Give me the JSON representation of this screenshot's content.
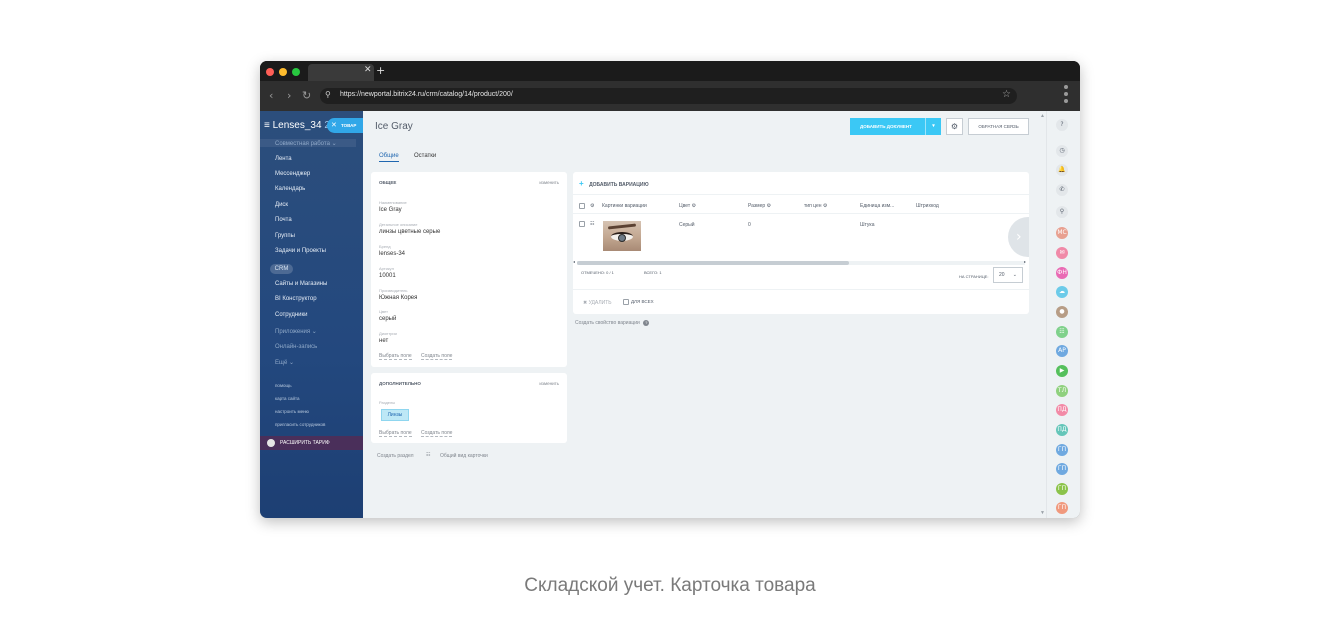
{
  "browser": {
    "url": "https://newportal.bitrix24.ru/crm/catalog/14/product/200/",
    "tab_close": "✕",
    "tab_new": "+",
    "nav_back": "‹",
    "nav_forward": "›",
    "nav_reload": "↻",
    "search_icon": "⚲",
    "star_icon": "☆"
  },
  "sidebar": {
    "logo_text": "Lenses_34",
    "logo_num": "24",
    "hamburger": "≡",
    "tovar_close": "✕",
    "tovar_label": "ТОВАР",
    "group_label": "Совместная работа ⌄",
    "items": [
      "Лента",
      "Мессенджер",
      "Календарь",
      "Диск",
      "Почта",
      "Группы",
      "Задачи и Проекты"
    ],
    "crm": "CRM",
    "items2": [
      "Сайты и Магазины",
      "BI Конструктор",
      "Сотрудники",
      "Приложения ⌄",
      "Онлайн-запись",
      "Ещё ⌄"
    ],
    "small_links": [
      "помощь",
      "карта сайта",
      "настроить меню",
      "пригласить сотрудников"
    ],
    "expand_label": "РАСШИРИТЬ ТАРИФ"
  },
  "header": {
    "title": "Ice Gray",
    "add_doc": "ДОБАВИТЬ ДОКУМЕНТ",
    "add_doc_arrow": "▾",
    "gear": "⚙",
    "feedback": "ОБРАТНАЯ СВЯЗЬ"
  },
  "tabs": [
    "Общие",
    "Остатки"
  ],
  "general_card": {
    "title": "ОБЩЕЕ",
    "edit": "изменить",
    "fields": [
      {
        "label": "Наименование",
        "value": "Ice Gray"
      },
      {
        "label": "Детальное описание",
        "value": "линзы цветные серые"
      },
      {
        "label": "Бренд",
        "value": "lenses-34"
      },
      {
        "label": "Артикул",
        "value": "10001"
      },
      {
        "label": "Производитель",
        "value": "Южная Корея"
      },
      {
        "label": "Цвет",
        "value": "серый"
      },
      {
        "label": "Диоптрии",
        "value": "нет"
      }
    ],
    "choose_field": "Выбрать поле",
    "create_field": "Создать поле"
  },
  "extra_card": {
    "title": "ДОПОЛНИТЕЛЬНО",
    "edit": "изменить",
    "sections_label": "Разделы",
    "section_chip": "Линзы",
    "choose_field": "Выбрать поле",
    "create_field": "Создать поле"
  },
  "below": {
    "create_section": "Создать раздел",
    "card_icon": "☷",
    "general_view": "Общий вид карточки"
  },
  "variations": {
    "add_plus": "+",
    "add_label": "ДОБАВИТЬ ВАРИАЦИЮ",
    "gear": "⚙",
    "columns": [
      "Картинки вариации",
      "Цвет ⚙",
      "Размер ⚙",
      "тип цен ⚙",
      "Единица изм...",
      "Штрихкод"
    ],
    "row": {
      "icon": "☷",
      "color": "Серый",
      "size": "0",
      "unit": "Штука"
    },
    "selected": "ОТМЕЧЕНО: 0 / 1",
    "total": "ВСЕГО: 1",
    "per_page_label": "НА СТРАНИЦЕ:",
    "per_page_value": "20",
    "per_page_chevron": "⌄",
    "delete_icon": "✖",
    "delete_label": "УДАЛИТЬ",
    "for_all": "ДЛЯ ВСЕХ",
    "next_icon": "›",
    "scroll_left": "◂",
    "scroll_right": "▸",
    "create_property": "Создать свойство вариации",
    "help_icon": "?"
  },
  "rightbar": {
    "scroll_up": "▲",
    "scroll_down": "▼",
    "icons": [
      {
        "name": "help-icon",
        "text": "?",
        "color": "#e3e7ea"
      },
      {
        "name": "timer-icon",
        "text": "◷",
        "color": "#e3e7ea"
      },
      {
        "name": "bell-icon",
        "text": "🔔",
        "color": "#e3e7ea"
      },
      {
        "name": "phone-icon",
        "text": "✆",
        "color": "#e3e7ea"
      },
      {
        "name": "search-icon",
        "text": "⚲",
        "color": "#e3e7ea"
      },
      {
        "name": "avatar-mc",
        "text": "МС",
        "color": "#e8a090"
      },
      {
        "name": "avatar-pink",
        "text": "✉",
        "color": "#f08aa8"
      },
      {
        "name": "avatar-fn",
        "text": "ФН",
        "color": "#e96bb4"
      },
      {
        "name": "avatar-chat",
        "text": "☁",
        "color": "#6ccbe9"
      },
      {
        "name": "avatar-photo",
        "text": "●",
        "color": "#b79d86"
      },
      {
        "name": "avatar-green",
        "text": "☷",
        "color": "#7fd18b"
      },
      {
        "name": "avatar-ap",
        "text": "АР",
        "color": "#6fa9e0"
      },
      {
        "name": "avatar-video",
        "text": "▶",
        "color": "#55c05c"
      },
      {
        "name": "avatar-tl",
        "text": "ТЛ",
        "color": "#8fd17e"
      },
      {
        "name": "avatar-pd",
        "text": "ПД",
        "color": "#f28aa6"
      },
      {
        "name": "avatar-pg",
        "text": "ПД",
        "color": "#64c6b9"
      },
      {
        "name": "avatar-gp1",
        "text": "ГП",
        "color": "#6fa9e0"
      },
      {
        "name": "avatar-gp2",
        "text": "ГП",
        "color": "#6fa9e0"
      },
      {
        "name": "avatar-gp3",
        "text": "ГП",
        "color": "#8bc34a"
      },
      {
        "name": "avatar-gp4",
        "text": "ГП",
        "color": "#f0997d"
      }
    ]
  },
  "caption": "Складской учет. Карточка товара"
}
